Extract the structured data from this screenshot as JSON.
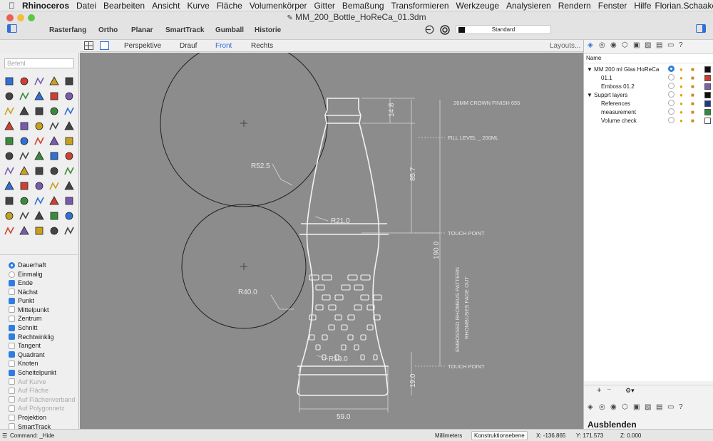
{
  "menubar": {
    "apple": "",
    "app": "Rhinoceros",
    "items": [
      "Datei",
      "Bearbeiten",
      "Ansicht",
      "Kurve",
      "Fläche",
      "Volumenkörper",
      "Gitter",
      "Bemaßung",
      "Transformieren",
      "Werkzeuge",
      "Analysieren",
      "Rendern",
      "Fenster",
      "Hilfe"
    ],
    "user": "Florian.Schaake"
  },
  "window": {
    "title": "MM_200_Bottle_HoReCa_01.3dm"
  },
  "toolbar": {
    "rasterfang": "Rasterfang",
    "ortho": "Ortho",
    "planar": "Planar",
    "smarttrack": "SmartTrack",
    "gumball": "Gumball",
    "historie": "Historie",
    "layer_value": "Standard"
  },
  "viewtabs": {
    "perspektive": "Perspektive",
    "drauf": "Drauf",
    "front": "Front",
    "rechts": "Rechts",
    "layouts": "Layouts..."
  },
  "command": {
    "placeholder": "Befehl",
    "last": "Command: _Hide"
  },
  "osnap": {
    "mode1": "Dauerhaft",
    "mode2": "Einmalig",
    "items": [
      {
        "label": "Ende",
        "on": true
      },
      {
        "label": "Nächst",
        "on": false
      },
      {
        "label": "Punkt",
        "on": true
      },
      {
        "label": "Mittelpunkt",
        "on": false
      },
      {
        "label": "Zentrum",
        "on": false
      },
      {
        "label": "Schnitt",
        "on": true
      },
      {
        "label": "Rechtwinklig",
        "on": true
      },
      {
        "label": "Tangent",
        "on": false
      },
      {
        "label": "Quadrant",
        "on": true
      },
      {
        "label": "Knoten",
        "on": false
      },
      {
        "label": "Scheitelpunkt",
        "on": true
      },
      {
        "label": "Auf Kurve",
        "on": false,
        "disabled": true
      },
      {
        "label": "Auf Fläche",
        "on": false,
        "disabled": true
      },
      {
        "label": "Auf Flächenverband",
        "on": false,
        "disabled": true
      },
      {
        "label": "Auf Polygonnetz",
        "on": false,
        "disabled": true
      },
      {
        "label": "Projektion",
        "on": false
      },
      {
        "label": "SmartTrack",
        "on": false
      }
    ]
  },
  "layers": {
    "header": "Name",
    "rows": [
      {
        "name": "MM 200 ml Glas HoReCa",
        "level": 0,
        "expanded": true,
        "current": true,
        "color": "#111111"
      },
      {
        "name": "01.1",
        "level": 1,
        "color": "#d43b2a"
      },
      {
        "name": "Emboss 01.2",
        "level": 1,
        "color": "#7a62a8"
      },
      {
        "name": "Supprt layers",
        "level": 0,
        "expanded": true,
        "color": "#111111"
      },
      {
        "name": "References",
        "level": 1,
        "color": "#1e3a8a"
      },
      {
        "name": "measurement",
        "level": 1,
        "color": "#2e8b3a"
      },
      {
        "name": "Volume check",
        "level": 1,
        "color": "#ffffff"
      }
    ]
  },
  "ausblenden": "Ausblenden",
  "drawing": {
    "radii": [
      "R52.5",
      "R40.0",
      "R21.0",
      "R19.0"
    ],
    "dims": [
      "14.8",
      "85.7",
      "190.0",
      "19.0",
      "59.0"
    ],
    "notes": [
      "26MM CROWN FINISH 655",
      "FILL LEVEL _ 200ML",
      "TOUCH POINT",
      "TOUCH POINT",
      "EMBOSSED RHOMBUS PATTERN",
      "RHOMBUSES FADE OUT"
    ]
  },
  "status": {
    "units": "Millimeters",
    "cplane": "Konstruktionsebene",
    "x": "X: -136.865",
    "y": "Y: 171.573",
    "z": "Z: 0.000"
  }
}
